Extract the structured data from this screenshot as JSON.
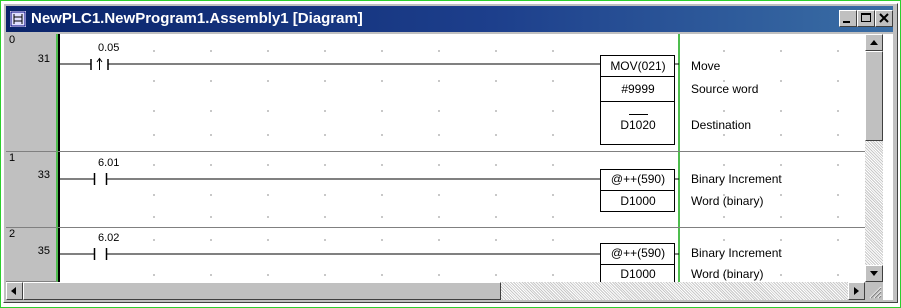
{
  "window": {
    "title": "NewPLC1.NewProgram1.Assembly1 [Diagram]",
    "icon": "ladder-program-icon",
    "buttons": [
      "minimize-icon",
      "maximize-icon",
      "close-icon"
    ]
  },
  "rungs": [
    {
      "rung": "0",
      "step": "31",
      "contact": {
        "address": "0.05",
        "type": "differentiated-up"
      },
      "instruction": {
        "mnemonic": "MOV(021)",
        "operands": [
          "#9999",
          "D1020"
        ]
      },
      "comments": [
        "Move",
        "Source word",
        "Destination"
      ]
    },
    {
      "rung": "1",
      "step": "33",
      "contact": {
        "address": "6.01",
        "type": "normally-open"
      },
      "instruction": {
        "mnemonic": "@++(590)",
        "operands": [
          "D1000"
        ]
      },
      "comments": [
        "Binary Increment",
        "Word (binary)"
      ]
    },
    {
      "rung": "2",
      "step": "35",
      "contact": {
        "address": "6.02",
        "type": "normally-open"
      },
      "instruction": {
        "mnemonic": "@++(590)",
        "operands": [
          "D1000"
        ]
      },
      "comments": [
        "Binary Increment",
        "Word (binary)"
      ]
    }
  ],
  "colors": {
    "titlebar": "#0a246a",
    "right_bus": "#4ebd4e",
    "outer_border": "#2dcf2d"
  }
}
